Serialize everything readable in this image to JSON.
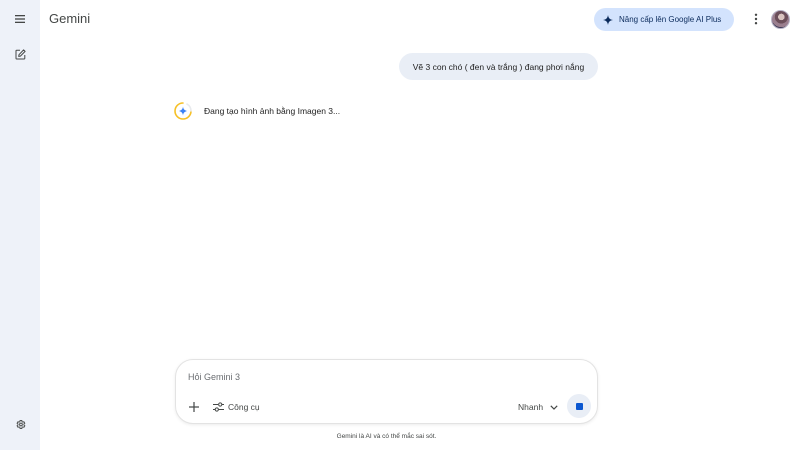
{
  "app": {
    "title": "Gemini"
  },
  "header": {
    "upgrade_label": "Nâng cấp lên Google AI Plus",
    "upgrade_icon": "sparkle-icon",
    "menu_icon": "more-vert-icon"
  },
  "sidebar": {
    "menu_icon": "hamburger-icon",
    "new_chat_icon": "edit-icon",
    "settings_icon": "gear-icon"
  },
  "chat": {
    "user_message": "Vẽ 3 con chó ( đen và trắng ) đang phơi nắng",
    "status_text": "Đang tạo hình ảnh bằng Imagen 3..."
  },
  "composer": {
    "placeholder": "Hỏi Gemini 3",
    "tools_label": "Công cụ",
    "model_label": "Nhanh"
  },
  "footer": {
    "disclaimer": "Gemini là AI và có thể mắc sai sót."
  },
  "colors": {
    "accent": "#0b57d0",
    "sidebar_bg": "#eef2f9",
    "upgrade_bg": "#d3e3fd",
    "bubble_bg": "#e9eef6"
  }
}
